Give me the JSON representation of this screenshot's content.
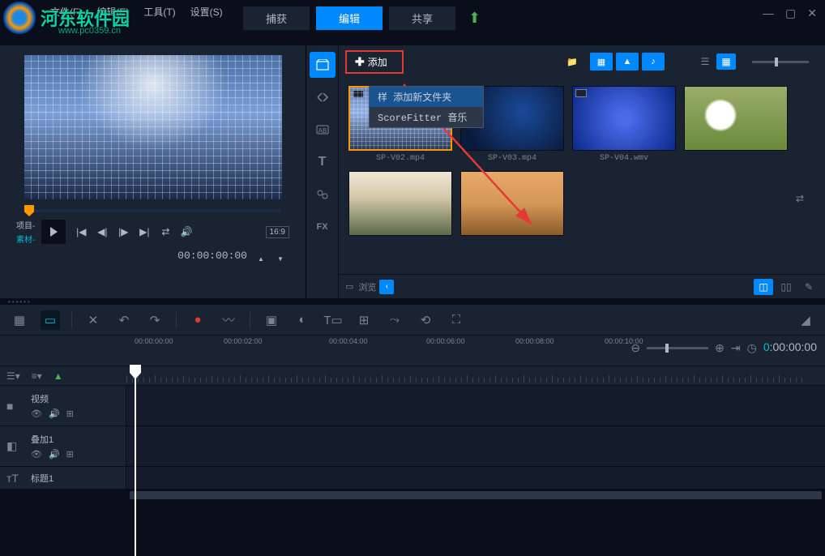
{
  "watermark": {
    "text": "河东软件园",
    "url": "www.pc0359.cn"
  },
  "menu": {
    "file": "文件(F)",
    "edit": "编辑(E)",
    "tools": "工具(T)",
    "settings": "设置(S)"
  },
  "topTabs": {
    "capture": "捕获",
    "edit": "编辑",
    "share": "共享"
  },
  "preview": {
    "projectLabel": "项目-",
    "materialLabel": "素材-",
    "aspect": "16:9",
    "timecode": "00:00:00:00"
  },
  "library": {
    "addLabel": "添加",
    "dropdown": {
      "sample": "样",
      "newFolder": "添加新文件夹",
      "music": "ScoreFitter 音乐"
    },
    "browseLabel": "浏览",
    "sidebarFx": "FX",
    "thumbs": [
      {
        "name": "SP-V02.mp4"
      },
      {
        "name": "SP-V03.mp4"
      },
      {
        "name": "SP-V04.wmv"
      },
      {
        "name": ""
      },
      {
        "name": ""
      },
      {
        "name": ""
      }
    ]
  },
  "timeline": {
    "ticks": [
      "00:00:00:00",
      "00:00:02:00",
      "00:00:04:00",
      "00:00:06:00",
      "00:00:08:00",
      "00:00:10:00"
    ],
    "currentTime": {
      "hours": "0",
      "rest": ":00:00:00"
    }
  },
  "tracks": {
    "video": "视频",
    "overlay": "叠加1",
    "title": "标题1"
  }
}
